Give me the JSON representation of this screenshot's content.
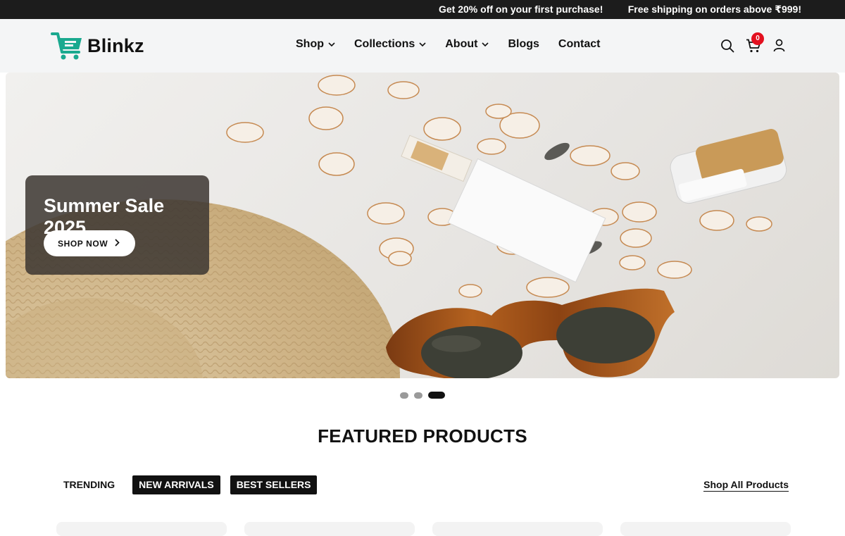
{
  "announcement": {
    "left_text": "Get 20% off on your first purchase!",
    "right_text": "Free shipping on orders above ₹999!"
  },
  "header": {
    "logo_text": "Blinkz",
    "brand_color": "#1aa98f",
    "nav": [
      {
        "label": "Shop",
        "has_dropdown": true
      },
      {
        "label": "Collections",
        "has_dropdown": true
      },
      {
        "label": "About",
        "has_dropdown": true
      },
      {
        "label": "Blogs",
        "has_dropdown": false
      },
      {
        "label": "Contact",
        "has_dropdown": false
      }
    ],
    "icons": [
      "search-icon",
      "cart-icon",
      "account-icon"
    ],
    "cart_count": "0",
    "cart_badge_color": "#e3101f"
  },
  "hero": {
    "title": "Summer Sale 2025",
    "cta_label": "SHOP NOW",
    "slides_total": 3,
    "active_slide": 3
  },
  "featured": {
    "title": "FEATURED PRODUCTS",
    "tabs": [
      {
        "label": "TRENDING",
        "active": false
      },
      {
        "label": "NEW ARRIVALS",
        "active": true
      },
      {
        "label": "BEST SELLERS",
        "active": true
      }
    ],
    "shop_all_label": "Shop All Products"
  }
}
